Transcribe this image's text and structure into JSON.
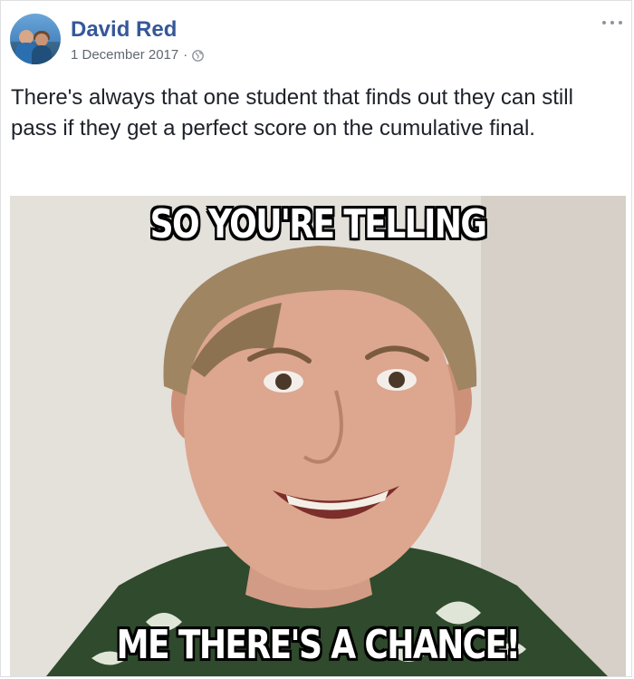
{
  "post": {
    "author": {
      "name": "David Red",
      "avatar_icon": "profile-photo"
    },
    "date": "1 December 2017",
    "separator": "·",
    "privacy_icon": "globe-icon",
    "more_icon": "more-options-icon",
    "caption": "There's always that one student that finds out they can still pass if they get a perfect score on the cumulative final.",
    "meme": {
      "top_text": "SO YOU'RE TELLING",
      "bottom_text": "ME THERE'S A CHANCE!"
    }
  },
  "colors": {
    "name": "#365899",
    "meta": "#616770",
    "text": "#1d2129",
    "border": "#dddfe2"
  }
}
